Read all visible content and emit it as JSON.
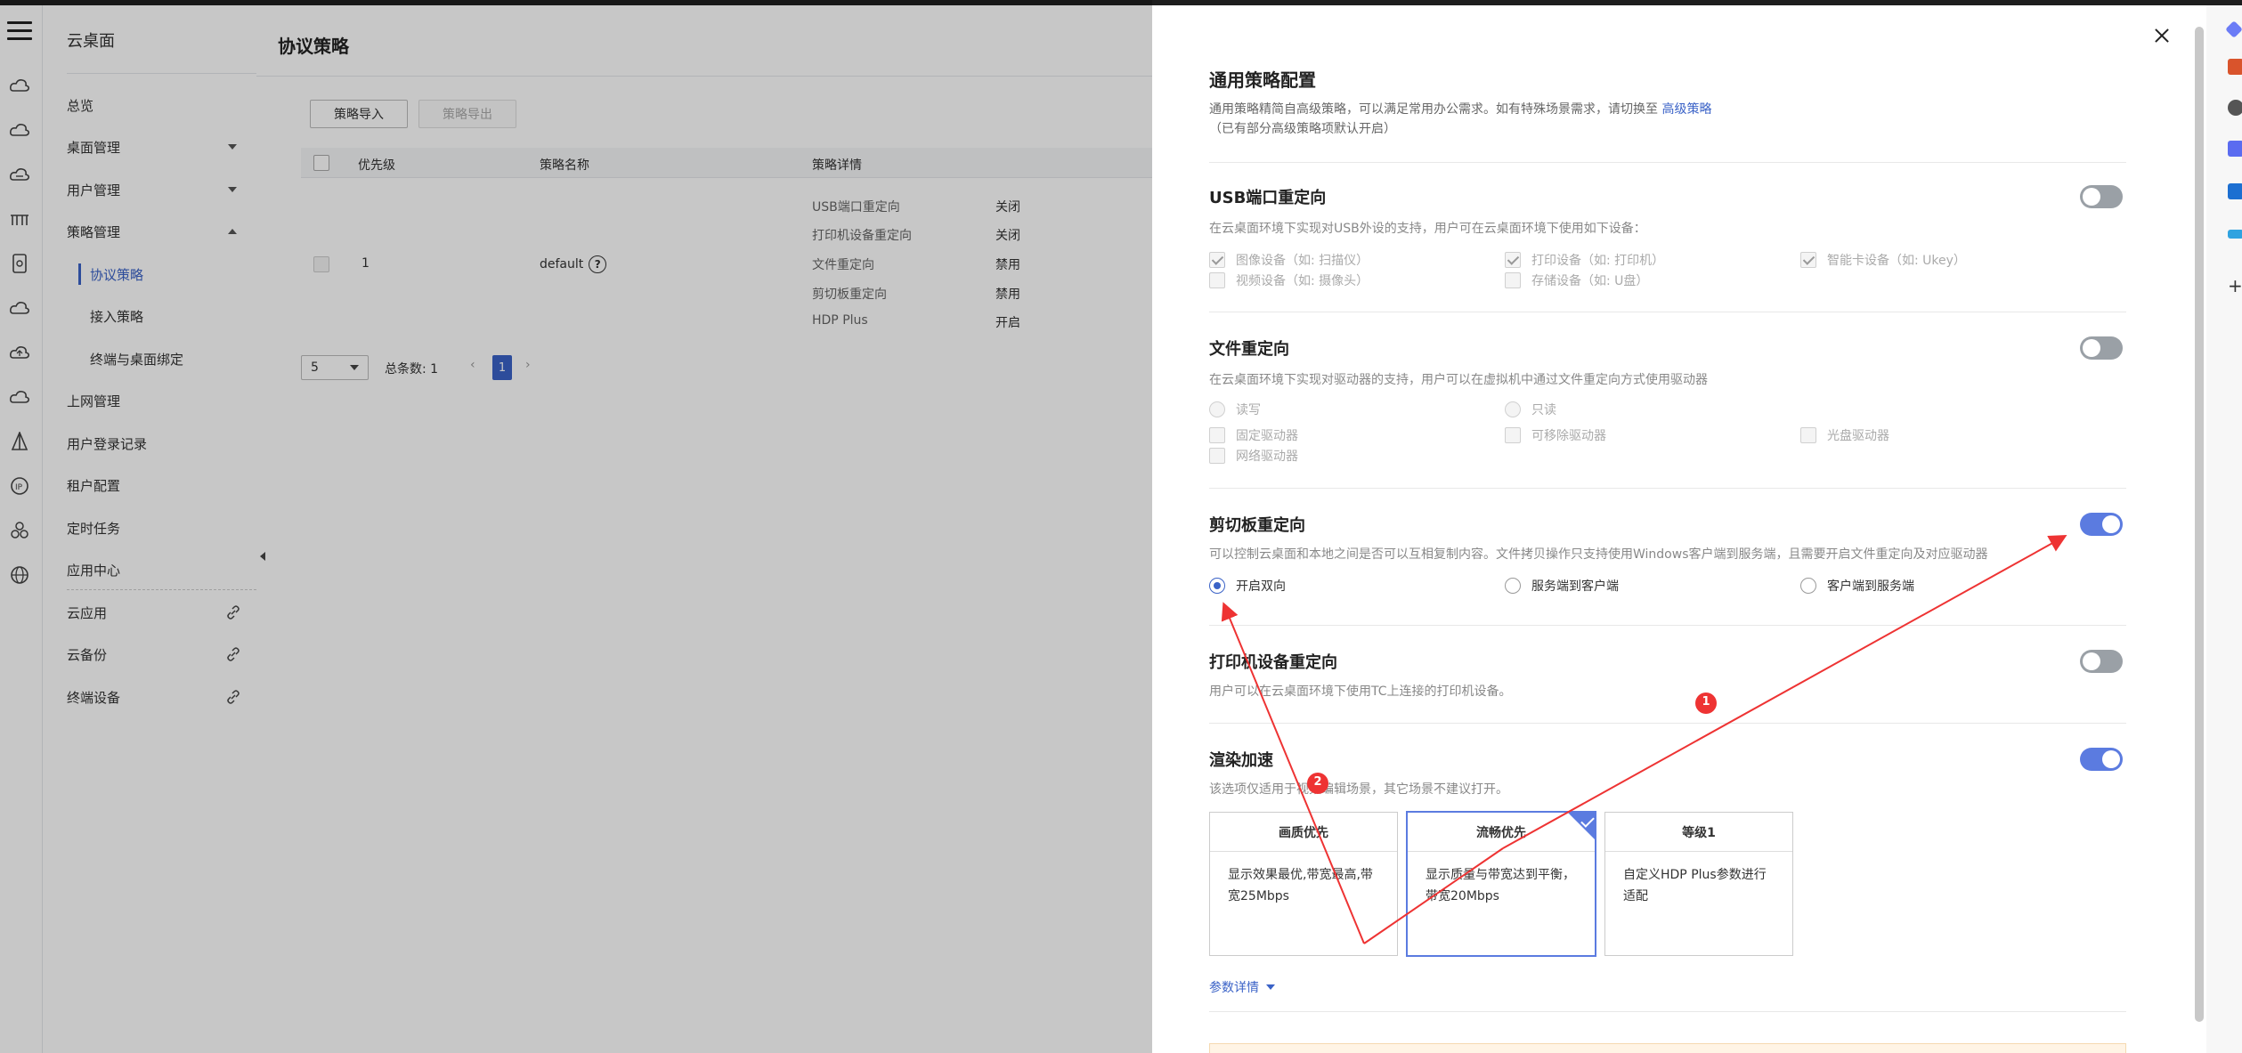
{
  "sidebar": {
    "title": "云桌面",
    "items": [
      {
        "label": "总览"
      },
      {
        "label": "桌面管理"
      },
      {
        "label": "用户管理"
      },
      {
        "label": "策略管理"
      },
      {
        "label": "协议策略"
      },
      {
        "label": "接入策略"
      },
      {
        "label": "终端与桌面绑定"
      },
      {
        "label": "上网管理"
      },
      {
        "label": "用户登录记录"
      },
      {
        "label": "租户配置"
      },
      {
        "label": "定时任务"
      },
      {
        "label": "应用中心"
      },
      {
        "label": "云应用"
      },
      {
        "label": "云备份"
      },
      {
        "label": "终端设备"
      }
    ]
  },
  "main": {
    "title": "协议策略",
    "import_label": "策略导入",
    "export_label": "策略导出",
    "columns": [
      "优先级",
      "策略名称",
      "策略详情"
    ],
    "row": {
      "priority": "1",
      "name": "default",
      "details": [
        {
          "key": "USB端口重定向",
          "value": "关闭"
        },
        {
          "key": "打印机设备重定向",
          "value": "关闭"
        },
        {
          "key": "文件重定向",
          "value": "禁用"
        },
        {
          "key": "剪切板重定向",
          "value": "禁用"
        },
        {
          "key": "HDP Plus",
          "value": "开启"
        }
      ]
    },
    "pager": {
      "page_size": "5",
      "total_label": "总条数: 1",
      "current_page": "1"
    }
  },
  "drawer": {
    "title": "通用策略配置",
    "desc_line1": "通用策略精简自高级策略，可以满足常用办公需求。如有特殊场景需求，请切换至",
    "desc_link": "高级策略",
    "desc_line2": "（已有部分高级策略项默认开启）",
    "usb": {
      "title": "USB端口重定向",
      "desc": "在云桌面环境下实现对USB外设的支持，用户可在云桌面环境下使用如下设备：",
      "enabled": false,
      "options": [
        "图像设备（如: 扫描仪）",
        "打印设备（如: 打印机）",
        "智能卡设备（如: Ukey）",
        "视频设备（如: 摄像头）",
        "存储设备（如: U盘）"
      ]
    },
    "file": {
      "title": "文件重定向",
      "desc": "在云桌面环境下实现对驱动器的支持，用户可以在虚拟机中通过文件重定向方式使用驱动器",
      "enabled": false,
      "modes": [
        "读写",
        "只读"
      ],
      "drives": [
        "固定驱动器",
        "可移除驱动器",
        "光盘驱动器",
        "网络驱动器"
      ]
    },
    "clipboard": {
      "title": "剪切板重定向",
      "desc": "可以控制云桌面和本地之间是否可以互相复制内容。文件拷贝操作只支持使用Windows客户端到服务端，且需要开启文件重定向及对应驱动器",
      "enabled": true,
      "options": [
        "开启双向",
        "服务端到客户端",
        "客户端到服务端"
      ],
      "selected": "开启双向"
    },
    "printer": {
      "title": "打印机设备重定向",
      "desc": "用户可以在云桌面环境下使用TC上连接的打印机设备。",
      "enabled": false
    },
    "render": {
      "title": "渲染加速",
      "desc": "该选项仅适用于视频编辑场景，其它场景不建议打开。",
      "enabled": true,
      "cards": [
        {
          "title": "画质优先",
          "body": "显示效果最优,带宽最高,带宽25Mbps"
        },
        {
          "title": "流畅优先",
          "body": "显示质量与带宽达到平衡，带宽20Mbps"
        },
        {
          "title": "等级1",
          "body": "自定义HDP Plus参数进行适配"
        }
      ],
      "selected": "流畅优先",
      "more_label": "参数详情"
    }
  },
  "annotations": [
    {
      "label": "1"
    },
    {
      "label": "2"
    }
  ],
  "colors": {
    "accent": "#3a62c7",
    "toggle_on": "#5b7be0",
    "annotation": "#ee3333"
  }
}
